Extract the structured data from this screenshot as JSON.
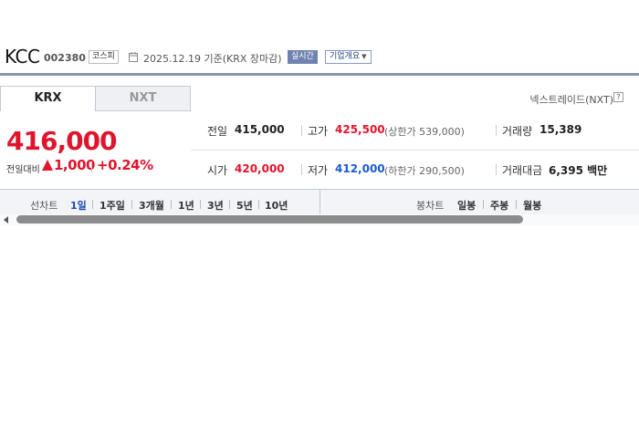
{
  "header": {
    "company_name": "KCC",
    "company_code": "002380",
    "market": "코스피",
    "base_date": "2025.12.19 기준(KRX 장마감)",
    "live_label": "실시간",
    "overview_label": "기업개요"
  },
  "tabs": [
    {
      "label": "KRX",
      "active": true
    },
    {
      "label": "NXT",
      "active": false
    }
  ],
  "nxt_link": "넥스트레이드(NXT)",
  "price": {
    "current": "416,000",
    "change_label": "전일대비",
    "change_amount": "1,000",
    "change_rate": "+0.24%",
    "direction": "up"
  },
  "stats": {
    "prev_close": {
      "label": "전일",
      "value": "415,000"
    },
    "high": {
      "label": "고가",
      "value": "425,500",
      "sub": "(상한가 539,000)"
    },
    "volume": {
      "label": "거래량",
      "value": "15,389"
    },
    "open": {
      "label": "시가",
      "value": "420,000"
    },
    "low": {
      "label": "저가",
      "value": "412,000",
      "sub": "(하한가 290,500)"
    },
    "amount": {
      "label": "거래대금",
      "value": "6,395 백만"
    }
  },
  "chart_periods": {
    "line_label": "선차트",
    "line_items": [
      "1일",
      "1주일",
      "3개월",
      "1년",
      "3년",
      "5년",
      "10년"
    ],
    "candle_label": "봉차트",
    "candle_items": [
      "일봉",
      "주봉",
      "월봉"
    ],
    "active": "1일"
  },
  "colors": {
    "up": "#e0152d",
    "down": "#1a5bd0",
    "active_period": "#1a48b0"
  }
}
